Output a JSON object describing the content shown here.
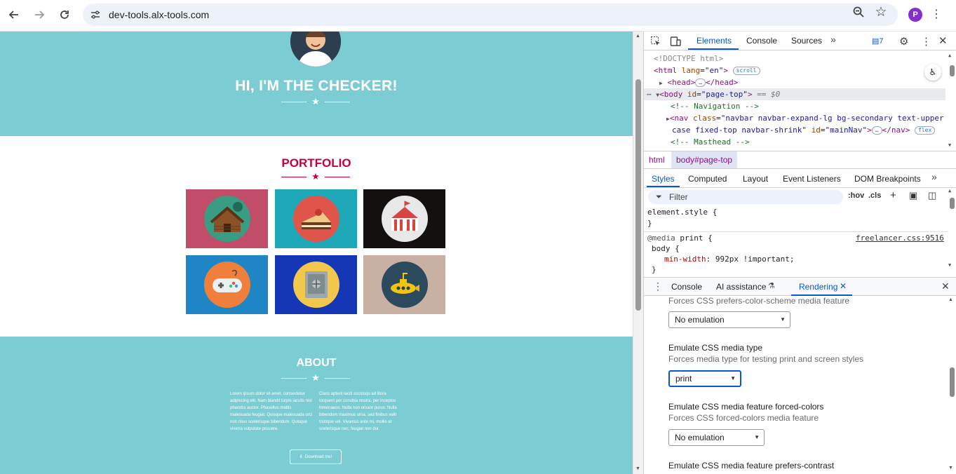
{
  "browser": {
    "url": "dev-tools.alx-tools.com",
    "profile_initial": "P",
    "back_icon": "arrow-left-icon",
    "forward_icon": "arrow-right-icon",
    "reload_icon": "reload-icon",
    "bookmark_icon": "star-icon",
    "menu_icon": "kebab-icon"
  },
  "site": {
    "hero_title": "HI, I'M THE CHECKER!",
    "portfolio_title": "PORTFOLIO",
    "about_title": "ABOUT",
    "about_left": "Lorem ipsum dolor sit amet, consectetur adipiscing elit. Nam blandit turpis iaculis nisl pharetra auctor. Phasellus mattis malesuada feugiat. Quisque malesuada orci non risus scelerisque bibendum. Quisque viverra vulputate posuere.",
    "about_right": "Class aptent taciti sociosqu ad litora torquent per conubia nostra, per inceptos himenaeos. Nulla non ornare purus. Nulla bibendum maximus urna, sed finibus velit tristique vel. Vivamus ante mi, mollis at scelerisque nec, feugiat non dui.",
    "download_label": "Download me!",
    "download_icon": "download-icon",
    "colors": {
      "teal": "#7bcdd3",
      "accent": "#c70039"
    },
    "tiles": [
      {
        "name": "cabin",
        "bg": "#c14d68"
      },
      {
        "name": "cake",
        "bg": "#1fa9b8"
      },
      {
        "name": "circus",
        "bg": "#141010"
      },
      {
        "name": "game",
        "bg": "#1e86c4"
      },
      {
        "name": "safe",
        "bg": "#1637b5"
      },
      {
        "name": "submarine",
        "bg": "#c8b1a3"
      }
    ]
  },
  "devtools": {
    "tabs": [
      "Elements",
      "Console",
      "Sources"
    ],
    "issues_count": "7",
    "dom": {
      "doctype": "<!DOCTYPE html>",
      "html_open": "<html",
      "html_attr": "lang",
      "html_val": "\"en\"",
      "scroll_pill": "scroll",
      "head": "<head>",
      "head_close": "</head>",
      "body_open": "<body",
      "body_attr": "id",
      "body_val": "\"page-top\"",
      "body_eq": "== $0",
      "comment_nav": "<!-- Navigation -->",
      "nav_open": "<nav",
      "nav_attr": "class",
      "nav_val1": "\"navbar navbar-expand-lg bg-secondary text-upper",
      "nav_val2": "case fixed-top navbar-shrink\"",
      "nav_id_attr": "id",
      "nav_id_val": "\"mainNav\"",
      "nav_close": "</nav>",
      "flex_pill": "flex",
      "comment_masthead": "<!-- Masthead -->"
    },
    "breadcrumbs": [
      "html",
      "body#page-top"
    ],
    "style_tabs": [
      "Styles",
      "Computed",
      "Layout",
      "Event Listeners",
      "DOM Breakpoints"
    ],
    "filter_placeholder": "Filter",
    "hov": ":hov",
    "cls": ".cls",
    "styles": {
      "element_style": "element.style {",
      "close_brace": "}",
      "media": "@media",
      "media_type": "print {",
      "source": "freelancer.css:9516",
      "selector": "body {",
      "prop": "min-width",
      "value": "992px !important;",
      "close_inner": "}"
    },
    "drawer_tabs": [
      "Console",
      "AI assistance",
      "Rendering"
    ],
    "rendering": {
      "desc_top": "Forces CSS prefers-color-scheme media feature",
      "sel1": "No emulation",
      "title2": "Emulate CSS media type",
      "desc2": "Forces media type for testing print and screen styles",
      "sel2": "print",
      "title3": "Emulate CSS media feature forced-colors",
      "desc3": "Forces CSS forced-colors media feature",
      "sel3": "No emulation",
      "title4": "Emulate CSS media feature prefers-contrast"
    }
  }
}
